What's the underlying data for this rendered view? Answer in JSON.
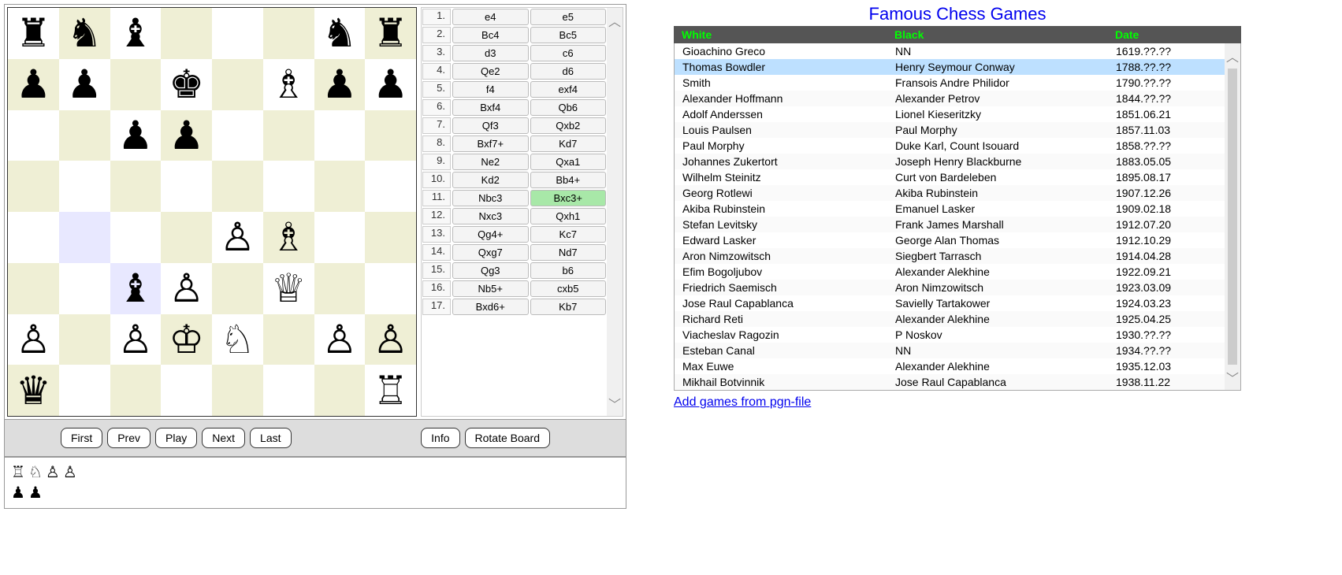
{
  "board": {
    "position": [
      [
        "r",
        "n",
        "b",
        "",
        "",
        "",
        "n",
        "r"
      ],
      [
        "p",
        "p",
        "",
        "k",
        "",
        "B",
        "p",
        "p"
      ],
      [
        "",
        "",
        "p",
        "p",
        "",
        "",
        "",
        ""
      ],
      [
        "",
        "",
        "",
        "",
        "",
        "",
        "",
        ""
      ],
      [
        "",
        "",
        "",
        "",
        "P",
        "B",
        "",
        ""
      ],
      [
        "",
        "",
        "b",
        "P",
        "",
        "Q",
        "",
        ""
      ],
      [
        "P",
        "",
        "P",
        "K",
        "N",
        "",
        "P",
        "P"
      ],
      [
        "q",
        "",
        "",
        "",
        "",
        "",
        "",
        "R"
      ]
    ],
    "highlights": [
      [
        4,
        1
      ],
      [
        5,
        2
      ]
    ]
  },
  "moves": [
    {
      "n": 1,
      "w": "e4",
      "b": "e5"
    },
    {
      "n": 2,
      "w": "Bc4",
      "b": "Bc5"
    },
    {
      "n": 3,
      "w": "d3",
      "b": "c6"
    },
    {
      "n": 4,
      "w": "Qe2",
      "b": "d6"
    },
    {
      "n": 5,
      "w": "f4",
      "b": "exf4"
    },
    {
      "n": 6,
      "w": "Bxf4",
      "b": "Qb6"
    },
    {
      "n": 7,
      "w": "Qf3",
      "b": "Qxb2"
    },
    {
      "n": 8,
      "w": "Bxf7+",
      "b": "Kd7"
    },
    {
      "n": 9,
      "w": "Ne2",
      "b": "Qxa1"
    },
    {
      "n": 10,
      "w": "Kd2",
      "b": "Bb4+"
    },
    {
      "n": 11,
      "w": "Nbc3",
      "b": "Bxc3+"
    },
    {
      "n": 12,
      "w": "Nxc3",
      "b": "Qxh1"
    },
    {
      "n": 13,
      "w": "Qg4+",
      "b": "Kc7"
    },
    {
      "n": 14,
      "w": "Qxg7",
      "b": "Nd7"
    },
    {
      "n": 15,
      "w": "Qg3",
      "b": "b6"
    },
    {
      "n": 16,
      "w": "Nb5+",
      "b": "cxb5"
    },
    {
      "n": 17,
      "w": "Bxd6+",
      "b": "Kb7"
    }
  ],
  "current_move": {
    "n": 11,
    "side": "b"
  },
  "controls": {
    "first": "First",
    "prev": "Prev",
    "play": "Play",
    "next": "Next",
    "last": "Last",
    "info": "Info",
    "rotate": "Rotate Board"
  },
  "captured": {
    "white": [
      "R",
      "N",
      "P",
      "P"
    ],
    "black": [
      "p",
      "p"
    ]
  },
  "games_title": "Famous Chess Games",
  "games_headers": {
    "white": "White",
    "black": "Black",
    "date": "Date"
  },
  "games": [
    {
      "white": "Gioachino Greco",
      "black": "NN",
      "date": "1619.??.??"
    },
    {
      "white": "Thomas Bowdler",
      "black": "Henry Seymour Conway",
      "date": "1788.??.??"
    },
    {
      "white": "Smith",
      "black": "Fransois Andre Philidor",
      "date": "1790.??.??"
    },
    {
      "white": "Alexander Hoffmann",
      "black": "Alexander Petrov",
      "date": "1844.??.??"
    },
    {
      "white": "Adolf Anderssen",
      "black": "Lionel Kieseritzky",
      "date": "1851.06.21"
    },
    {
      "white": "Louis Paulsen",
      "black": "Paul Morphy",
      "date": "1857.11.03"
    },
    {
      "white": "Paul Morphy",
      "black": "Duke Karl, Count Isouard",
      "date": "1858.??.??"
    },
    {
      "white": "Johannes Zukertort",
      "black": "Joseph Henry Blackburne",
      "date": "1883.05.05"
    },
    {
      "white": "Wilhelm Steinitz",
      "black": "Curt von Bardeleben",
      "date": "1895.08.17"
    },
    {
      "white": "Georg Rotlewi",
      "black": "Akiba Rubinstein",
      "date": "1907.12.26"
    },
    {
      "white": "Akiba Rubinstein",
      "black": "Emanuel Lasker",
      "date": "1909.02.18"
    },
    {
      "white": "Stefan Levitsky",
      "black": "Frank James Marshall",
      "date": "1912.07.20"
    },
    {
      "white": "Edward Lasker",
      "black": "George Alan Thomas",
      "date": "1912.10.29"
    },
    {
      "white": "Aron Nimzowitsch",
      "black": "Siegbert Tarrasch",
      "date": "1914.04.28"
    },
    {
      "white": "Efim Bogoljubov",
      "black": "Alexander Alekhine",
      "date": "1922.09.21"
    },
    {
      "white": "Friedrich Saemisch",
      "black": "Aron Nimzowitsch",
      "date": "1923.03.09"
    },
    {
      "white": "Jose Raul Capablanca",
      "black": "Savielly Tartakower",
      "date": "1924.03.23"
    },
    {
      "white": "Richard Reti",
      "black": "Alexander Alekhine",
      "date": "1925.04.25"
    },
    {
      "white": "Viacheslav Ragozin",
      "black": "P Noskov",
      "date": "1930.??.??"
    },
    {
      "white": "Esteban Canal",
      "black": "NN",
      "date": "1934.??.??"
    },
    {
      "white": "Max Euwe",
      "black": "Alexander Alekhine",
      "date": "1935.12.03"
    },
    {
      "white": "Mikhail Botvinnik",
      "black": "Jose Raul Capablanca",
      "date": "1938.11.22"
    }
  ],
  "selected_game_index": 1,
  "add_link": "Add games from pgn-file"
}
